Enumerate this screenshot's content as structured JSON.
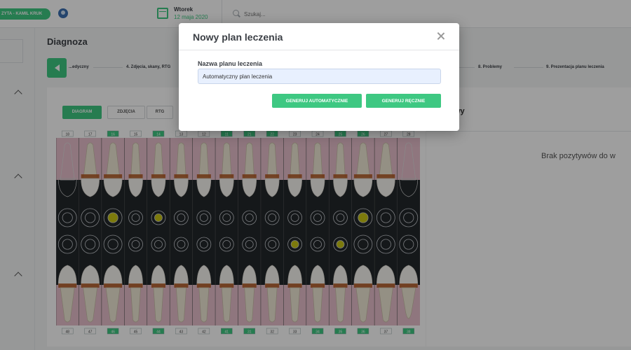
{
  "topbar": {
    "visit_label": "ZYTA - KAMIL KRUK",
    "date_day": "Wtorek",
    "date_full": "12 maja 2020",
    "search_placeholder": "Szukaj..."
  },
  "page": {
    "title": "Diagnoza",
    "steps": [
      "...edyczny",
      "4. Zdjęcia, skany, RTG",
      "8. Problemy",
      "9. Prezentacja planu leczenia"
    ]
  },
  "tabs": [
    "DIAGRAM",
    "ZDJĘCIA",
    "RTG"
  ],
  "upper_teeth": [
    "18",
    "17",
    "16",
    "15",
    "14",
    "13",
    "12",
    "11",
    "21",
    "22",
    "23",
    "24",
    "25",
    "26",
    "27",
    "28"
  ],
  "lower_teeth": [
    "48",
    "47",
    "46",
    "45",
    "44",
    "43",
    "42",
    "41",
    "31",
    "32",
    "33",
    "34",
    "35",
    "36",
    "37",
    "38"
  ],
  "highlighted_upper": [
    "16",
    "14",
    "11",
    "21",
    "22",
    "25",
    "26"
  ],
  "highlighted_lower": [
    "46",
    "44",
    "41",
    "31",
    "34",
    "35",
    "36",
    "38"
  ],
  "right_panel": {
    "heading": "wy",
    "empty_text": "Brak pozytywów do w"
  },
  "modal": {
    "title": "Nowy plan leczenia",
    "field_label": "Nazwa planu leczenia",
    "field_value": "Automatyczny plan leczenia",
    "btn_auto": "GENERUJ AUTOMATYCZNIE",
    "btn_manual": "GENERUJ RĘCZNIE"
  },
  "colors": {
    "accent": "#3ec882",
    "gum": "#e7bfcb",
    "chart_dark": "#22272b",
    "filling": "#c8c614",
    "overlay": "rgba(0,0,0,0.38)"
  }
}
